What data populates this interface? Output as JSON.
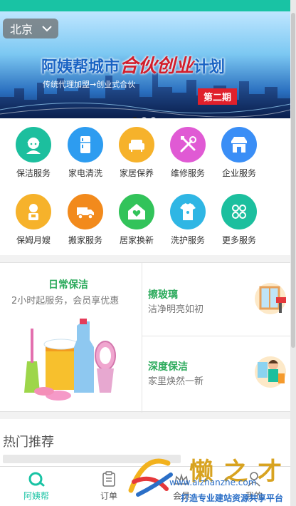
{
  "banner": {
    "city": "北京",
    "title_part1": "阿姨帮城市",
    "title_highlight": "合伙创业",
    "title_part2": "计划",
    "subtitle": "传统代理加盟→创业式合伙",
    "badge": "第二期",
    "slides": 3,
    "active_slide": 0
  },
  "services": [
    {
      "label": "保洁服务",
      "icon": "cleaning-person-icon",
      "color": "#1cbf9e"
    },
    {
      "label": "家电清洗",
      "icon": "refrigerator-icon",
      "color": "#2d9cf0"
    },
    {
      "label": "家居保养",
      "icon": "sofa-icon",
      "color": "#f6b22b"
    },
    {
      "label": "维修服务",
      "icon": "tools-icon",
      "color": "#e05ad4"
    },
    {
      "label": "企业服务",
      "icon": "storefront-icon",
      "color": "#3a8ef6"
    },
    {
      "label": "保姆月嫂",
      "icon": "nanny-icon",
      "color": "#f6b22b"
    },
    {
      "label": "搬家服务",
      "icon": "truck-icon",
      "color": "#f28a1c"
    },
    {
      "label": "居家换新",
      "icon": "house-heart-icon",
      "color": "#32c35a"
    },
    {
      "label": "洗护服务",
      "icon": "laundry-shirt-icon",
      "color": "#2fb6e4"
    },
    {
      "label": "更多服务",
      "icon": "more-grid-icon",
      "color": "#1cbf9e"
    }
  ],
  "promos": {
    "daily": {
      "title": "日常保洁",
      "subtitle": "2小时起服务，会员享优惠"
    },
    "glass": {
      "title": "擦玻璃",
      "subtitle": "洁净明亮如初"
    },
    "deep": {
      "title": "深度保洁",
      "subtitle": "家里焕然一新"
    }
  },
  "hot": {
    "title": "热门推荐"
  },
  "tabs": [
    {
      "label": "阿姨帮",
      "icon": "home-logo-icon",
      "active": true
    },
    {
      "label": "订单",
      "icon": "order-clipboard-icon",
      "active": false
    },
    {
      "label": "会员",
      "icon": "crown-icon",
      "active": false
    },
    {
      "label": "我的",
      "icon": "user-icon",
      "active": false
    }
  ],
  "watermark": {
    "brand": "懒之才",
    "url": "www.aizhanzhe.com",
    "tagline": "打造专业建站资源共享平台"
  },
  "colors": {
    "accent": "#19c3a4",
    "promo_green": "#2baa5b",
    "banner_red": "#e0202b"
  }
}
